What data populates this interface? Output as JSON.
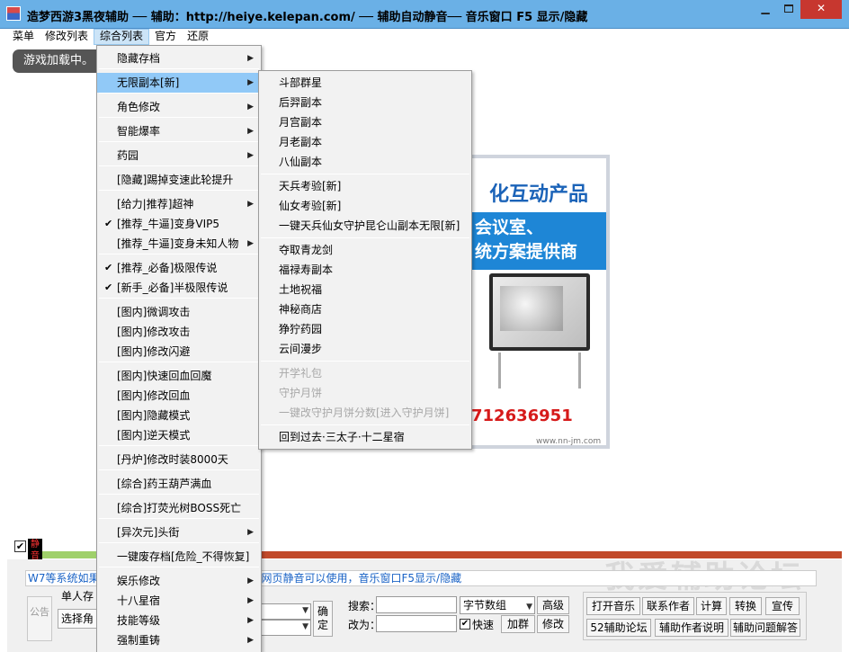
{
  "window": {
    "title": "造梦西游3黑夜辅助 ── 辅助：http://heiye.kelepan.com/ ── 辅助自动静音── 音乐窗口 F5 显示/隐藏",
    "minimize_label": "▁",
    "close_label": "✕"
  },
  "menubar": [
    "菜单",
    "修改列表",
    "综合列表",
    "官方",
    "还原"
  ],
  "main": {
    "loading_text": "游戏加载中。"
  },
  "ad": {
    "headline": "化互动产品",
    "line1": "会议室、",
    "line2": "统方案提供商",
    "phone": "712636951",
    "url": "www.nn-jm.com"
  },
  "comprehensive_menu": [
    {
      "label": "隐藏存档",
      "submenu": true
    },
    {
      "label": "无限副本[新]",
      "submenu": true,
      "highlight": true
    },
    {
      "label": "角色修改",
      "submenu": true
    },
    {
      "label": "智能爆率",
      "submenu": true
    },
    {
      "label": "药园",
      "submenu": true
    },
    {
      "label": "[隐藏]踢掉变速此轮提升"
    },
    {
      "label": "[给力|推荐]超神",
      "submenu": true
    },
    {
      "label": "[推荐_牛逼]变身VIP5",
      "checked": true
    },
    {
      "label": "[推荐_牛逼]变身未知人物",
      "submenu": true
    },
    {
      "label": "[推荐_必备]极限传说",
      "checked": true
    },
    {
      "label": "[新手_必备]半极限传说",
      "checked": true
    },
    {
      "label": "[图内]微调攻击"
    },
    {
      "label": "[图内]修改攻击"
    },
    {
      "label": "[图内]修改闪避"
    },
    {
      "label": "[图内]快速回血回魔"
    },
    {
      "label": "[图内]修改回血"
    },
    {
      "label": "[图内]隐藏模式"
    },
    {
      "label": "[图内]逆天模式"
    },
    {
      "label": "[丹炉]修改时装8000天"
    },
    {
      "label": "[综合]药王葫芦满血"
    },
    {
      "label": "[综合]打荧光树BOSS死亡"
    },
    {
      "label": "[异次元]头街",
      "submenu": true
    },
    {
      "label": "一键废存档[危险_不得恢复]"
    },
    {
      "label": "娱乐修改",
      "submenu": true
    },
    {
      "label": "十八星宿",
      "submenu": true
    },
    {
      "label": "技能等级",
      "submenu": true
    },
    {
      "label": "强制重铸",
      "submenu": true
    }
  ],
  "dungeon_submenu": [
    {
      "label": "斗部群星"
    },
    {
      "label": "后羿副本"
    },
    {
      "label": "月宫副本"
    },
    {
      "label": "月老副本"
    },
    {
      "label": "八仙副本"
    },
    {
      "label": "天兵考验[新]"
    },
    {
      "label": "仙女考验[新]"
    },
    {
      "label": "一键天兵仙女守护昆仑山副本无限[新]"
    },
    {
      "label": "夺取青龙剑"
    },
    {
      "label": "福禄寿副本"
    },
    {
      "label": "土地祝福"
    },
    {
      "label": "神秘商店"
    },
    {
      "label": "狰狞药园"
    },
    {
      "label": "云间漫步"
    },
    {
      "label": "开学礼包",
      "disabled": true
    },
    {
      "label": "守护月饼",
      "disabled": true
    },
    {
      "label": "一键改守护月饼分数[进入守护月饼]",
      "disabled": true
    },
    {
      "label": "回到过去·三太子·十二星宿"
    }
  ],
  "mute": {
    "label": "静音",
    "checked": true
  },
  "progress": {
    "fraction": 0.07
  },
  "bottom": {
    "notice": "W7等系统如果不能静音请使用浏览器网页静音，网页静音可以使用，音乐窗口F5显示/隐藏",
    "watermark": "我爱辅助论坛",
    "gonggao": "公告",
    "single_label": "单人存",
    "select_role": "选择角",
    "confirm": "确定",
    "search_label": "搜索：",
    "change_label": "改为：",
    "bytes_option": "字节数组",
    "fast_label": "快速",
    "btn_advanced": "高级",
    "btn_group": "加群",
    "btn_modify": "修改",
    "btn_music": "打开音乐",
    "btn_contact": "联系作者",
    "btn_calc": "计算",
    "btn_convert": "转换",
    "btn_promote": "宣传",
    "btn_forum": "52辅助论坛",
    "btn_author_note": "辅助作者说明",
    "btn_faq": "辅助问题解答"
  }
}
